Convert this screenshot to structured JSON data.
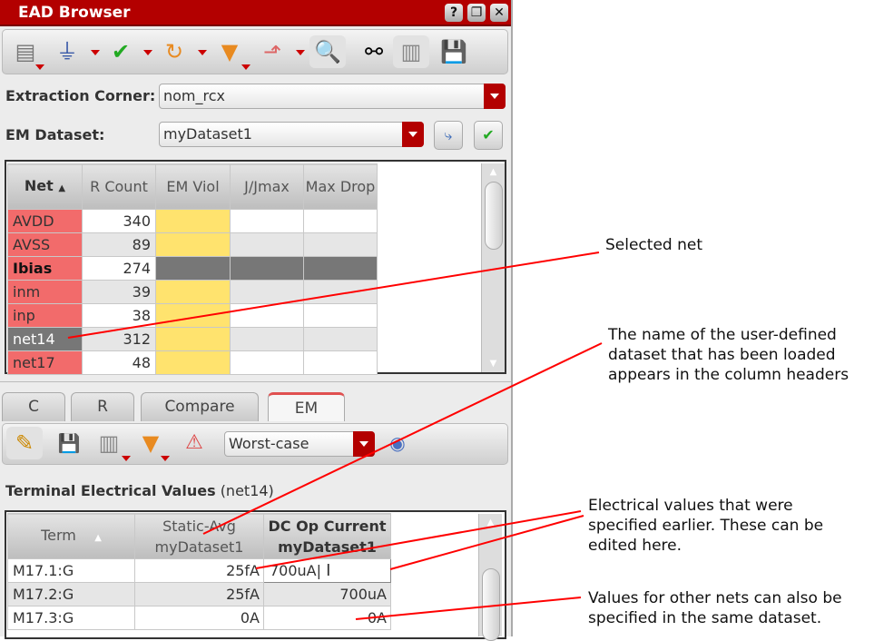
{
  "window": {
    "title": "EAD Browser",
    "help": "?",
    "restore": "❐",
    "close": "✕"
  },
  "form": {
    "extraction_corner_label": "Extraction Corner:",
    "extraction_corner_value": "nom_rcx",
    "em_dataset_label": "EM Dataset:",
    "em_dataset_value": "myDataset1"
  },
  "net_table": {
    "headers": [
      "Net",
      "R Count",
      "EM Viol",
      "J/Jmax",
      "Max Drop"
    ],
    "rows": [
      {
        "net": "AVDD",
        "count": "340"
      },
      {
        "net": "AVSS",
        "count": "89"
      },
      {
        "net": "Ibias",
        "count": "274"
      },
      {
        "net": "inm",
        "count": "39"
      },
      {
        "net": "inp",
        "count": "38"
      },
      {
        "net": "net14",
        "count": "312"
      },
      {
        "net": "net17",
        "count": "48"
      }
    ]
  },
  "tabs": [
    "C",
    "R",
    "Compare",
    "EM"
  ],
  "em_toolbar": {
    "mode_value": "Worst-case"
  },
  "terminal": {
    "title": "Terminal Electrical Values",
    "net": "(net14)",
    "headers": {
      "term": "Term",
      "static_line1": "Static-Avg",
      "static_line2": "myDataset1",
      "dc_line1": "DC Op Current",
      "dc_line2": "myDataset1"
    },
    "rows": [
      {
        "term": "M17.1:G",
        "static": "25fA",
        "dc": "700uA"
      },
      {
        "term": "M17.2:G",
        "static": "25fA",
        "dc": "700uA"
      },
      {
        "term": "M17.3:G",
        "static": "0A",
        "dc": "0A"
      }
    ]
  },
  "annotations": {
    "selected_net": "Selected net",
    "dataset_name": "The name of the user-defined dataset that has been loaded appears in the column headers",
    "electrical": "Electrical values that were specified earlier. These can be edited here.",
    "other_nets": "Values for other nets can also be specified in the same dataset."
  },
  "colors": {
    "title_red": "#b30000",
    "violation_pink": "#f26b6b",
    "em_yellow": "#ffe36e",
    "annotation_line": "#ff0000"
  }
}
